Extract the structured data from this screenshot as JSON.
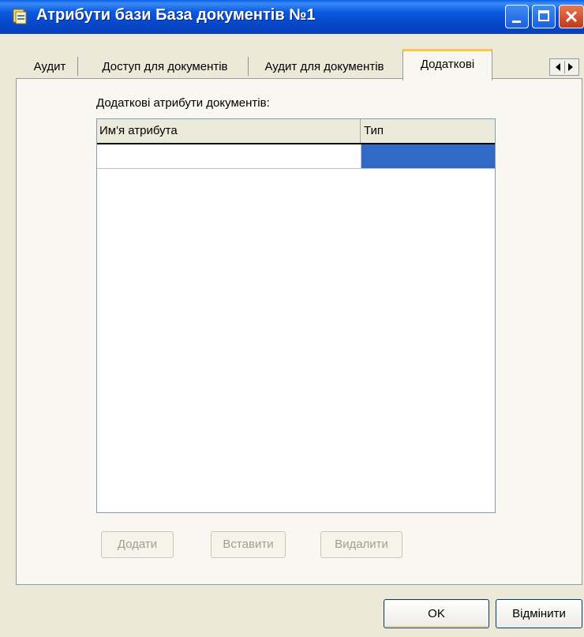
{
  "window": {
    "title": "Атрибути бази База документів №1",
    "icons": {
      "app": "database-icon",
      "minimize": "minimize-icon",
      "maximize": "maximize-icon",
      "close": "close-icon"
    }
  },
  "tabs": {
    "items": [
      {
        "label": "Аудит",
        "active": false
      },
      {
        "label": "Доступ для документів",
        "active": false
      },
      {
        "label": "Аудит для документів",
        "active": false
      },
      {
        "label": "Додаткові",
        "active": true
      }
    ],
    "scroll_icons": [
      "arrow-left-icon",
      "arrow-right-icon"
    ]
  },
  "panel": {
    "label": "Додаткові атрибути документів:",
    "columns": [
      "Им'я атрибута",
      "Тип"
    ],
    "rows": [
      {
        "name": "",
        "type": "",
        "selected": true
      }
    ],
    "selection_color": "#316AC5"
  },
  "buttons": {
    "add": "Додати",
    "insert": "Вставити",
    "delete": "Видалити",
    "ok": "OK",
    "cancel": "Відміни­ти"
  }
}
